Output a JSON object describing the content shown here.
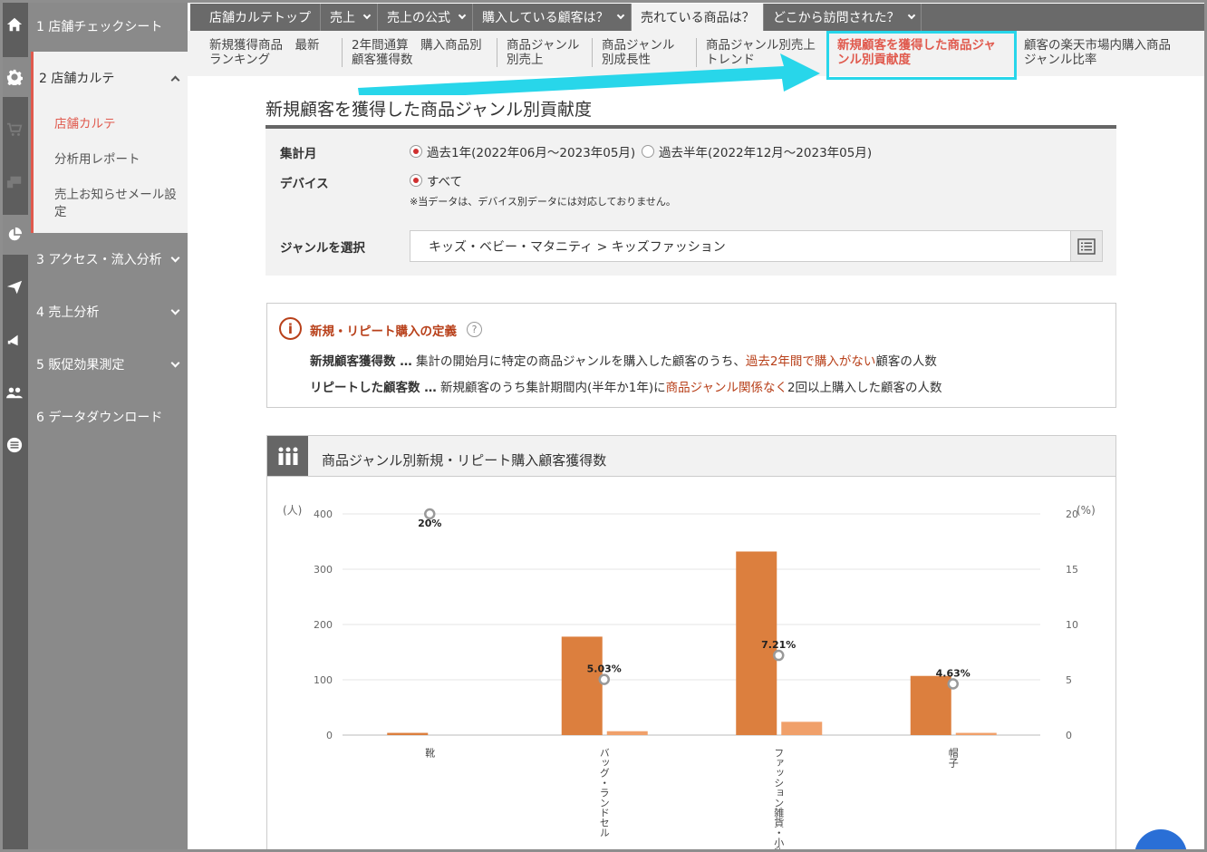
{
  "rail_icons": [
    "home-icon",
    "gear-icon",
    "cart-icon",
    "devices-icon",
    "pie-chart-icon",
    "send-icon",
    "megaphone-icon",
    "people-icon",
    "list-icon"
  ],
  "sidebar": {
    "s1": "1 店舗チェックシート",
    "s2": "2 店舗カルテ",
    "s2_items": [
      "店舗カルテ",
      "分析用レポート",
      "売上お知らせメール設定"
    ],
    "s3": "3 アクセス・流入分析",
    "s4": "4 売上分析",
    "s5": "5 販促効果測定",
    "s6": "6 データダウンロード"
  },
  "tabs": [
    "店舗カルテトップ",
    "売上",
    "売上の公式",
    "購入している顧客は？",
    "売れている商品は？",
    "どこから訪問された？"
  ],
  "subtabs": [
    [
      "新規獲得商品　最新",
      "ランキング"
    ],
    [
      "2年間通算　購入商品別",
      "顧客獲得数"
    ],
    [
      "商品ジャンル",
      "別売上"
    ],
    [
      "商品ジャンル",
      "別成長性"
    ],
    [
      "商品ジャンル別売上",
      "トレンド"
    ],
    [
      "新規顧客を獲得した商品ジャ",
      "ンル別貢献度"
    ],
    [
      "顧客の楽天市場内購入商品",
      "ジャンル比率"
    ]
  ],
  "page_title": "新規顧客を獲得した商品ジャンル別貢献度",
  "filter": {
    "period_label": "集計月",
    "period_opt1": "過去1年(2022年06月～2023年05月)",
    "period_opt2": "過去半年(2022年12月～2023年05月)",
    "device_label": "デバイス",
    "device_opt": "すべて",
    "device_note": "※当データは、デバイス別データには対応しておりません。",
    "genre_label": "ジャンルを選択",
    "genre_value": "キッズ・ベビー・マタニティ > キッズファッション"
  },
  "definition": {
    "title": "新規・リピート購入の定義",
    "l1_bold": "新規顧客獲得数 …",
    "l1_a": " 集計の開始月に特定の商品ジャンルを購入した顧客のうち、",
    "l1_red": "過去2年間で購入がない",
    "l1_b": "顧客の人数",
    "l2_bold": "リピートした顧客数 …",
    "l2_a": " 新規顧客のうち集計期間内(半年か1年)に",
    "l2_red": "商品ジャンル関係なく",
    "l2_b": "2回以上購入した顧客の人数"
  },
  "chart_section_title": "商品ジャンル別新規・リピート購入顧客獲得数",
  "chart_data": {
    "type": "bar",
    "title": "",
    "categories": [
      "靴",
      "バッグ・ランドセル",
      "ファッション雑貨・小物",
      "帽子"
    ],
    "series": [
      {
        "values": [
          4,
          178,
          332,
          107
        ],
        "color": "#dc7f3e"
      },
      {
        "values": [
          0,
          7,
          24,
          4
        ],
        "color": "#f0a06a"
      }
    ],
    "rate": {
      "values": [
        20,
        5.03,
        7.21,
        4.63
      ],
      "labels": [
        "20%",
        "5.03%",
        "7.21%",
        "4.63%"
      ]
    },
    "ylabel_left": "(人)",
    "ylabel_right": "(%)",
    "ylim": [
      0,
      400
    ],
    "ylim_right": [
      0,
      20
    ],
    "yticks": [
      "0",
      "100",
      "200",
      "300",
      "400"
    ],
    "yticks_right": [
      "0",
      "5",
      "10",
      "15",
      "20"
    ],
    "grid": true
  },
  "colors": {
    "accent_red": "#e05a4e",
    "highlight_cyan": "#28d6ea",
    "bar": "#dc7f3e",
    "bar_light": "#f0a06a"
  }
}
